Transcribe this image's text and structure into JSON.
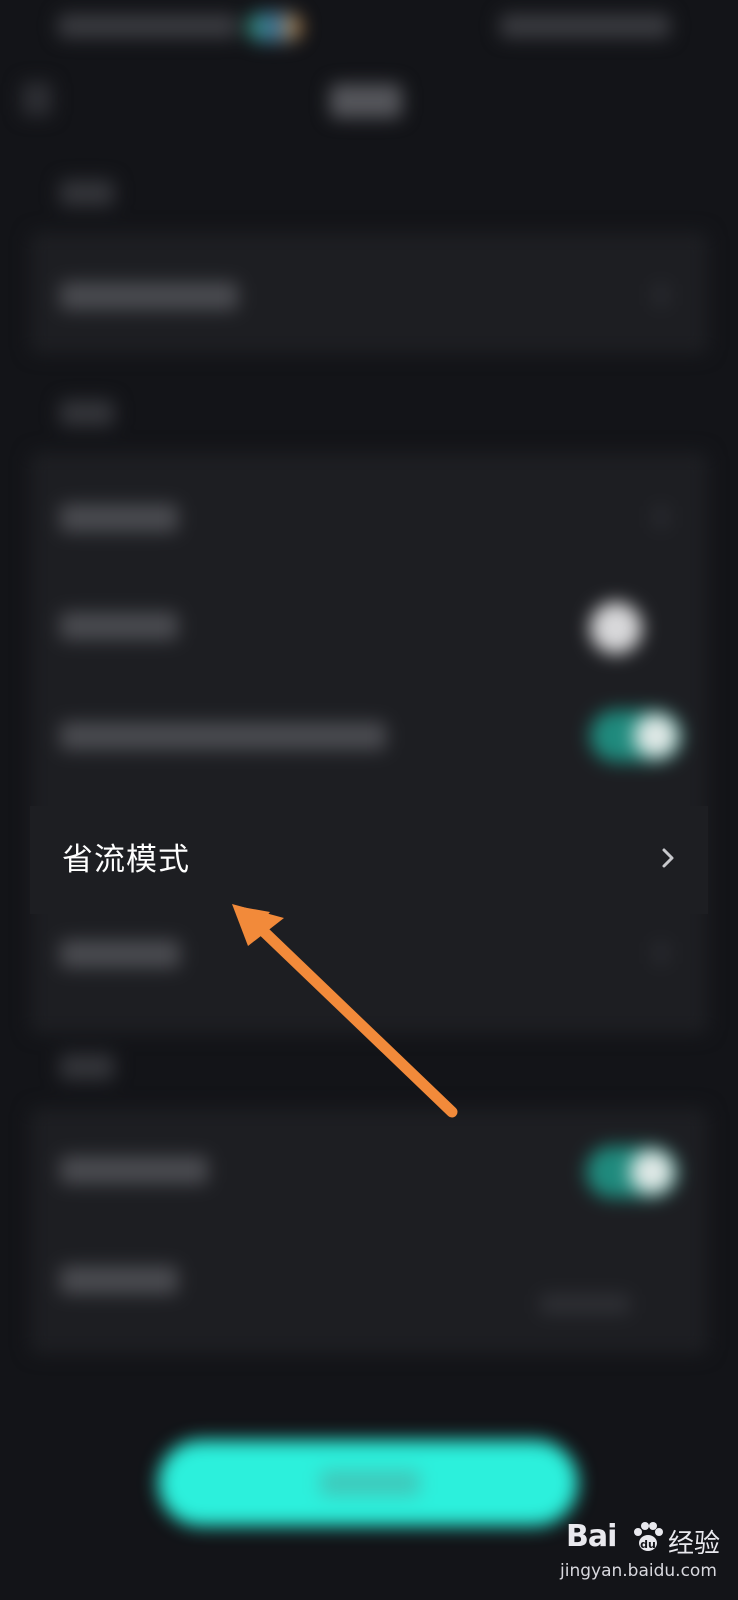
{
  "settings": {
    "highlighted_item_label": "省流模式"
  },
  "icons": {
    "chevron": "chevron-right-icon",
    "back": "back-arrow-icon",
    "annotation": "arrow-icon"
  },
  "colors": {
    "background": "#131418",
    "card": "#1d1e22",
    "accent": "#2cf0dc",
    "annotation_arrow": "#f28a3a"
  },
  "watermark": {
    "logo": "Bai",
    "logo_suffix": "经验",
    "url": "jingyan.baidu.com"
  }
}
